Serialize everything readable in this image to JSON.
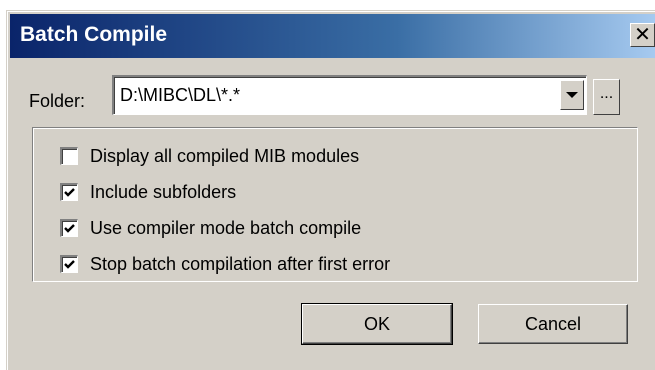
{
  "window": {
    "title": "Batch Compile",
    "close_glyph": "✕"
  },
  "folder": {
    "label": "Folder:",
    "value": "D:\\MIBC\\DL\\*.*",
    "browse_label": "..."
  },
  "options": [
    {
      "label": "Display all compiled MIB modules",
      "checked": false
    },
    {
      "label": "Include subfolders",
      "checked": true
    },
    {
      "label": "Use compiler mode batch compile",
      "checked": true
    },
    {
      "label": "Stop batch compilation after first error",
      "checked": true
    }
  ],
  "buttons": {
    "ok_label": "OK",
    "cancel_label": "Cancel"
  },
  "colors": {
    "title_gradient_start": "#0a246a",
    "title_gradient_end": "#a6caf0",
    "dialog_face": "#d4d0c8"
  }
}
